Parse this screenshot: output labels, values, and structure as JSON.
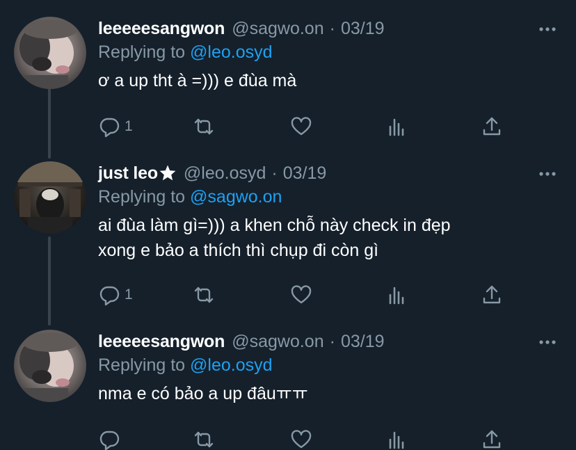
{
  "tweets": [
    {
      "display_name": "leeeeesangwon",
      "handle": "@sagwo.on",
      "dot": "·",
      "date": "03/19",
      "replying_prefix": "Replying to ",
      "replying_to": "@leo.osyd",
      "text": "ơ a up tht à =))) e đùa mà",
      "reply_count": "1",
      "avatar": "avatar-sangwon"
    },
    {
      "display_name": "just leo",
      "has_star": true,
      "handle": "@leo.osyd",
      "dot": "·",
      "date": "03/19",
      "replying_prefix": "Replying to ",
      "replying_to": "@sagwo.on",
      "text": "ai đùa làm gì=))) a khen chỗ này check in đẹp\nxong e bảo a thích thì chụp đi còn gì",
      "reply_count": "1",
      "avatar": "avatar-leo"
    },
    {
      "display_name": "leeeeesangwon",
      "handle": "@sagwo.on",
      "dot": "·",
      "date": "03/19",
      "replying_prefix": "Replying to ",
      "replying_to": "@leo.osyd",
      "text": "nma e có bảo a up đâuㅠㅠ",
      "reply_count": "",
      "avatar": "avatar-sangwon"
    }
  ],
  "icons": {
    "more": "more-dots-icon",
    "reply": "reply-bubble-icon",
    "retweet": "retweet-icon",
    "like": "heart-icon",
    "analytics": "analytics-bars-icon",
    "share": "share-upload-icon",
    "star": "star-icon"
  },
  "colors": {
    "background": "#15202b",
    "secondary_text": "#8899a6",
    "accent": "#1da1f2",
    "thread_line": "#38444d"
  }
}
